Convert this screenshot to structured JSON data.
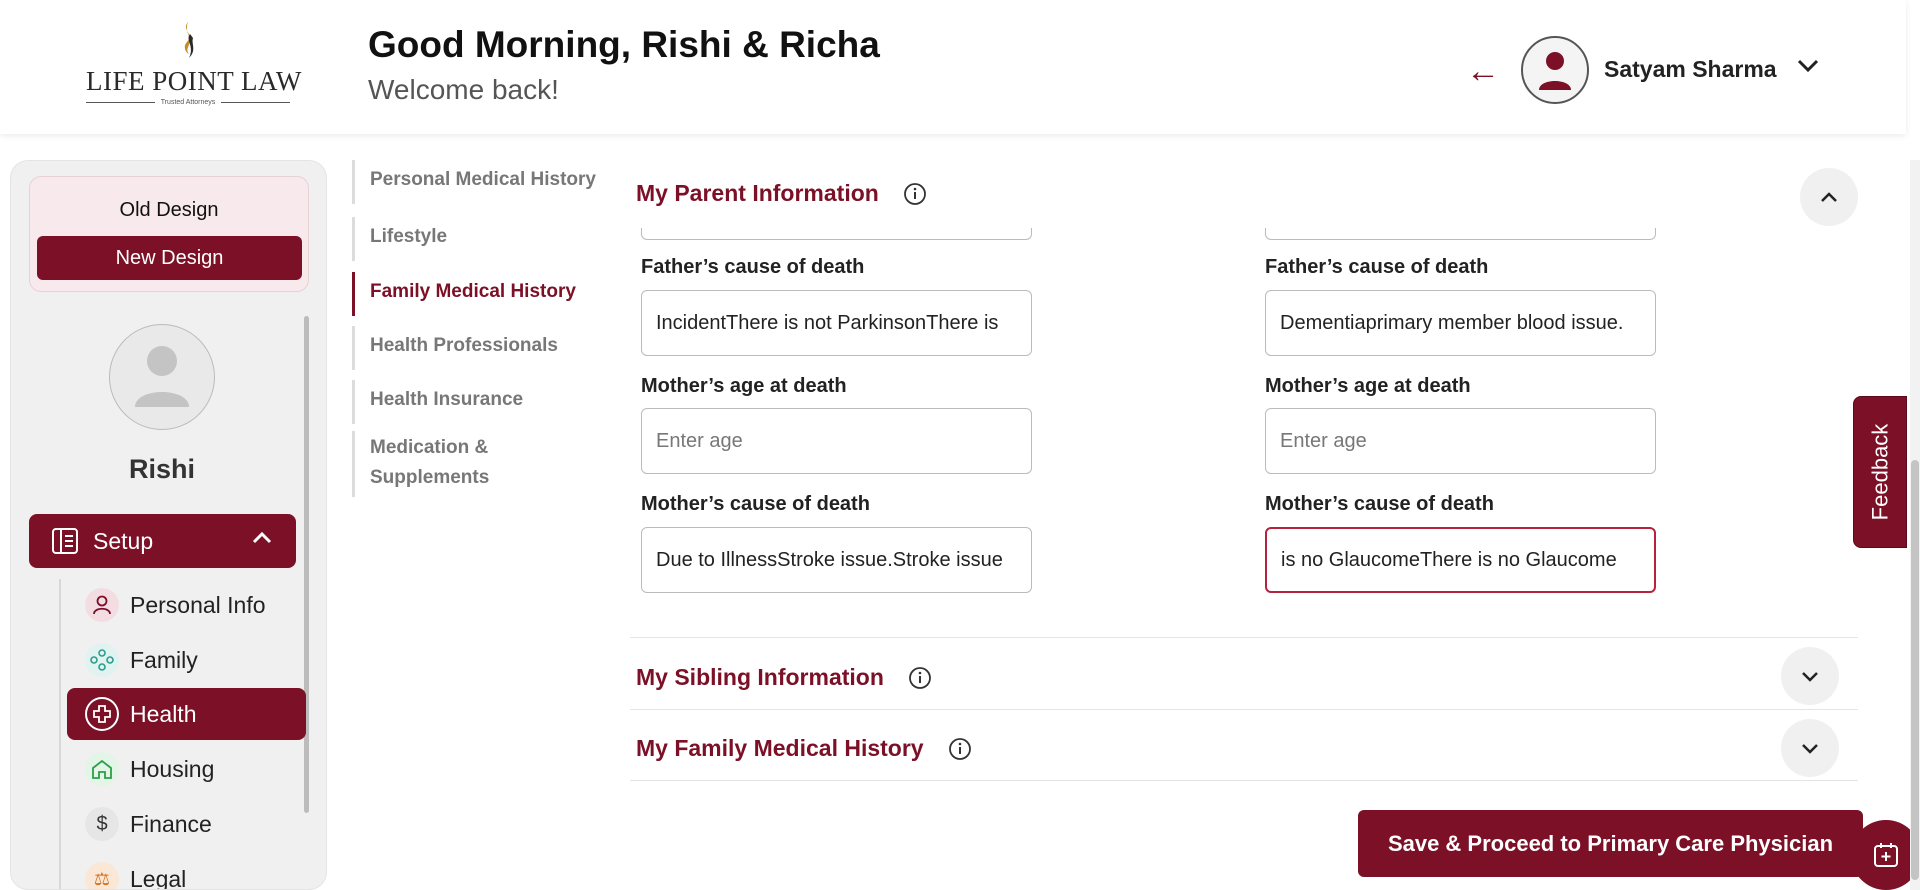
{
  "brand": {
    "name": "LIFE POINT LAW",
    "tagline": "Trusted Attorneys",
    "accent": "#7b1027"
  },
  "header": {
    "greeting": "Good Morning, Rishi & Richa",
    "subtitle": "Welcome back!"
  },
  "user": {
    "name": "Satyam Sharma"
  },
  "sidebar": {
    "old_design": "Old Design",
    "new_design": "New Design",
    "profile_name": "Rishi",
    "setup_label": "Setup",
    "items": [
      {
        "label": "Personal Info",
        "icon": "person-icon",
        "active": false
      },
      {
        "label": "Family",
        "icon": "family-icon",
        "active": false
      },
      {
        "label": "Health",
        "icon": "health-plus-icon",
        "active": true
      },
      {
        "label": "Housing",
        "icon": "home-icon",
        "active": false
      },
      {
        "label": "Finance",
        "icon": "dollar-icon",
        "active": false
      },
      {
        "label": "Legal",
        "icon": "legal-icon",
        "active": false
      }
    ]
  },
  "subnav": [
    {
      "label": "Personal Medical History",
      "active": false
    },
    {
      "label": "Lifestyle",
      "active": false
    },
    {
      "label": "Family Medical History",
      "active": true
    },
    {
      "label": "Health Professionals",
      "active": false
    },
    {
      "label": "Health Insurance",
      "active": false
    },
    {
      "label": "Medication & Supplements",
      "active": false
    }
  ],
  "parent_section": {
    "title": "My Parent Information",
    "left": {
      "father_cause_label": "Father’s cause of death",
      "father_cause_value": "IncidentThere is not ParkinsonThere is",
      "mother_age_label": "Mother’s age at death",
      "mother_age_placeholder": "Enter age",
      "mother_cause_label": "Mother’s cause of death",
      "mother_cause_value": "Due to IllnessStroke issue.Stroke issue"
    },
    "right": {
      "father_cause_label": "Father’s cause of death",
      "father_cause_value": "Dementiaprimary member blood issue.",
      "mother_age_label": "Mother’s age at death",
      "mother_age_placeholder": "Enter age",
      "mother_cause_label": "Mother’s cause of death",
      "mother_cause_value": "is no GlaucomeThere is no Glaucome"
    }
  },
  "sibling_section": {
    "title": "My Sibling Information"
  },
  "family_history_section": {
    "title": "My Family Medical History"
  },
  "actions": {
    "save_label": "Save & Proceed to Primary Care Physician",
    "feedback_label": "Feedback"
  }
}
